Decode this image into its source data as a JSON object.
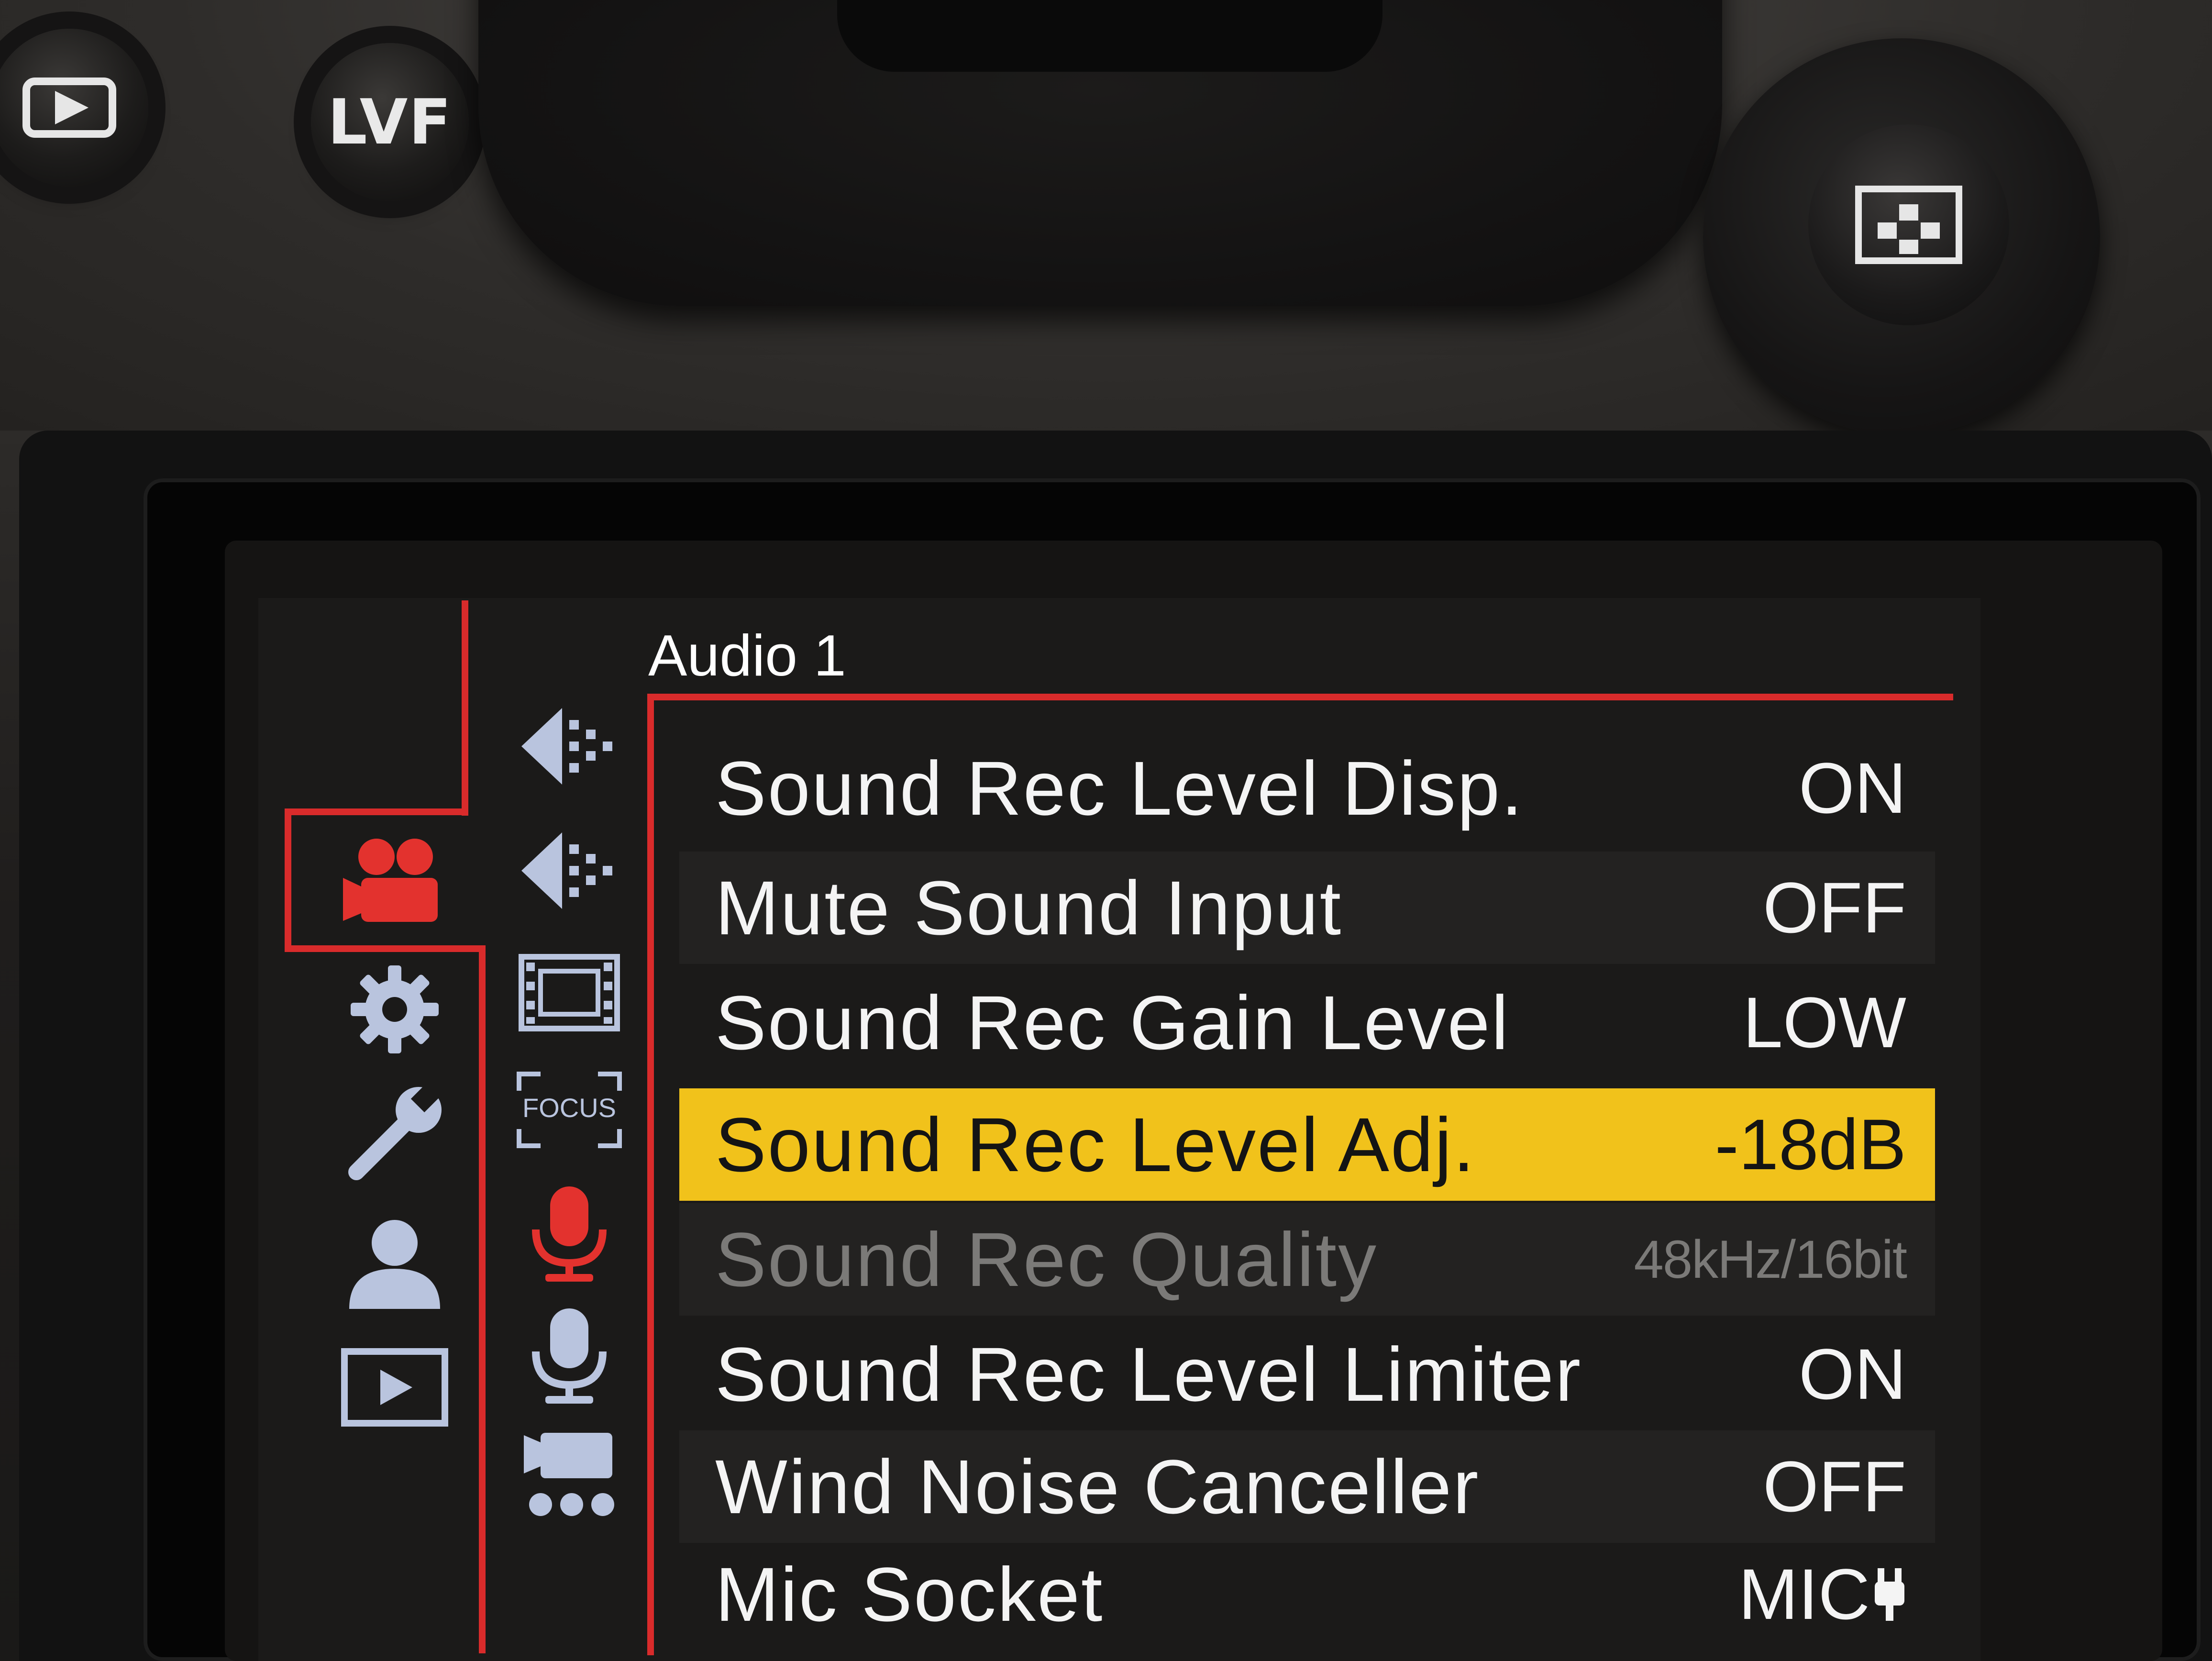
{
  "camera": {
    "buttons": [
      {
        "name": "playback-button",
        "icon": "play-icon",
        "label": ""
      },
      {
        "name": "lvf-button",
        "label": "LVF"
      },
      {
        "name": "joystick-button",
        "icon": "grid-icon",
        "label": ""
      }
    ]
  },
  "menu": {
    "title": "Audio 1",
    "accent_color": "#d92b2b",
    "highlight_color": "#f1c21b",
    "main_tabs": [
      {
        "icon": "video-camera-icon",
        "active": true
      },
      {
        "icon": "gear-icon",
        "active": false
      },
      {
        "icon": "wrench-icon",
        "active": false
      },
      {
        "icon": "user-icon",
        "active": false
      },
      {
        "icon": "playback-icon",
        "active": false
      }
    ],
    "sub_tabs": [
      {
        "icon": "image-quality-icon-1",
        "active": false
      },
      {
        "icon": "image-quality-icon-2",
        "active": false
      },
      {
        "icon": "film-icon",
        "active": false,
        "text": ""
      },
      {
        "icon": "focus-icon",
        "active": false,
        "text": "FOCUS"
      },
      {
        "icon": "microphone-icon",
        "active": true
      },
      {
        "icon": "microphone-icon-2",
        "active": false
      },
      {
        "icon": "video-others-icon",
        "active": false
      }
    ],
    "items": [
      {
        "label": "Sound Rec Level Disp.",
        "value": "ON",
        "state": "normal"
      },
      {
        "label": "Mute Sound Input",
        "value": "OFF",
        "state": "normal"
      },
      {
        "label": "Sound Rec Gain Level",
        "value": "LOW",
        "state": "normal"
      },
      {
        "label": "Sound Rec Level Adj.",
        "value": "-18dB",
        "state": "selected"
      },
      {
        "label": "Sound Rec Quality",
        "value": "48kHz/16bit",
        "state": "disabled"
      },
      {
        "label": "Sound Rec Level Limiter",
        "value": "ON",
        "state": "normal"
      },
      {
        "label": "Wind Noise Canceller",
        "value": "OFF",
        "state": "normal"
      },
      {
        "label": "Mic Socket",
        "value": "MIC",
        "value_icon": "plug-icon",
        "state": "normal"
      }
    ]
  }
}
